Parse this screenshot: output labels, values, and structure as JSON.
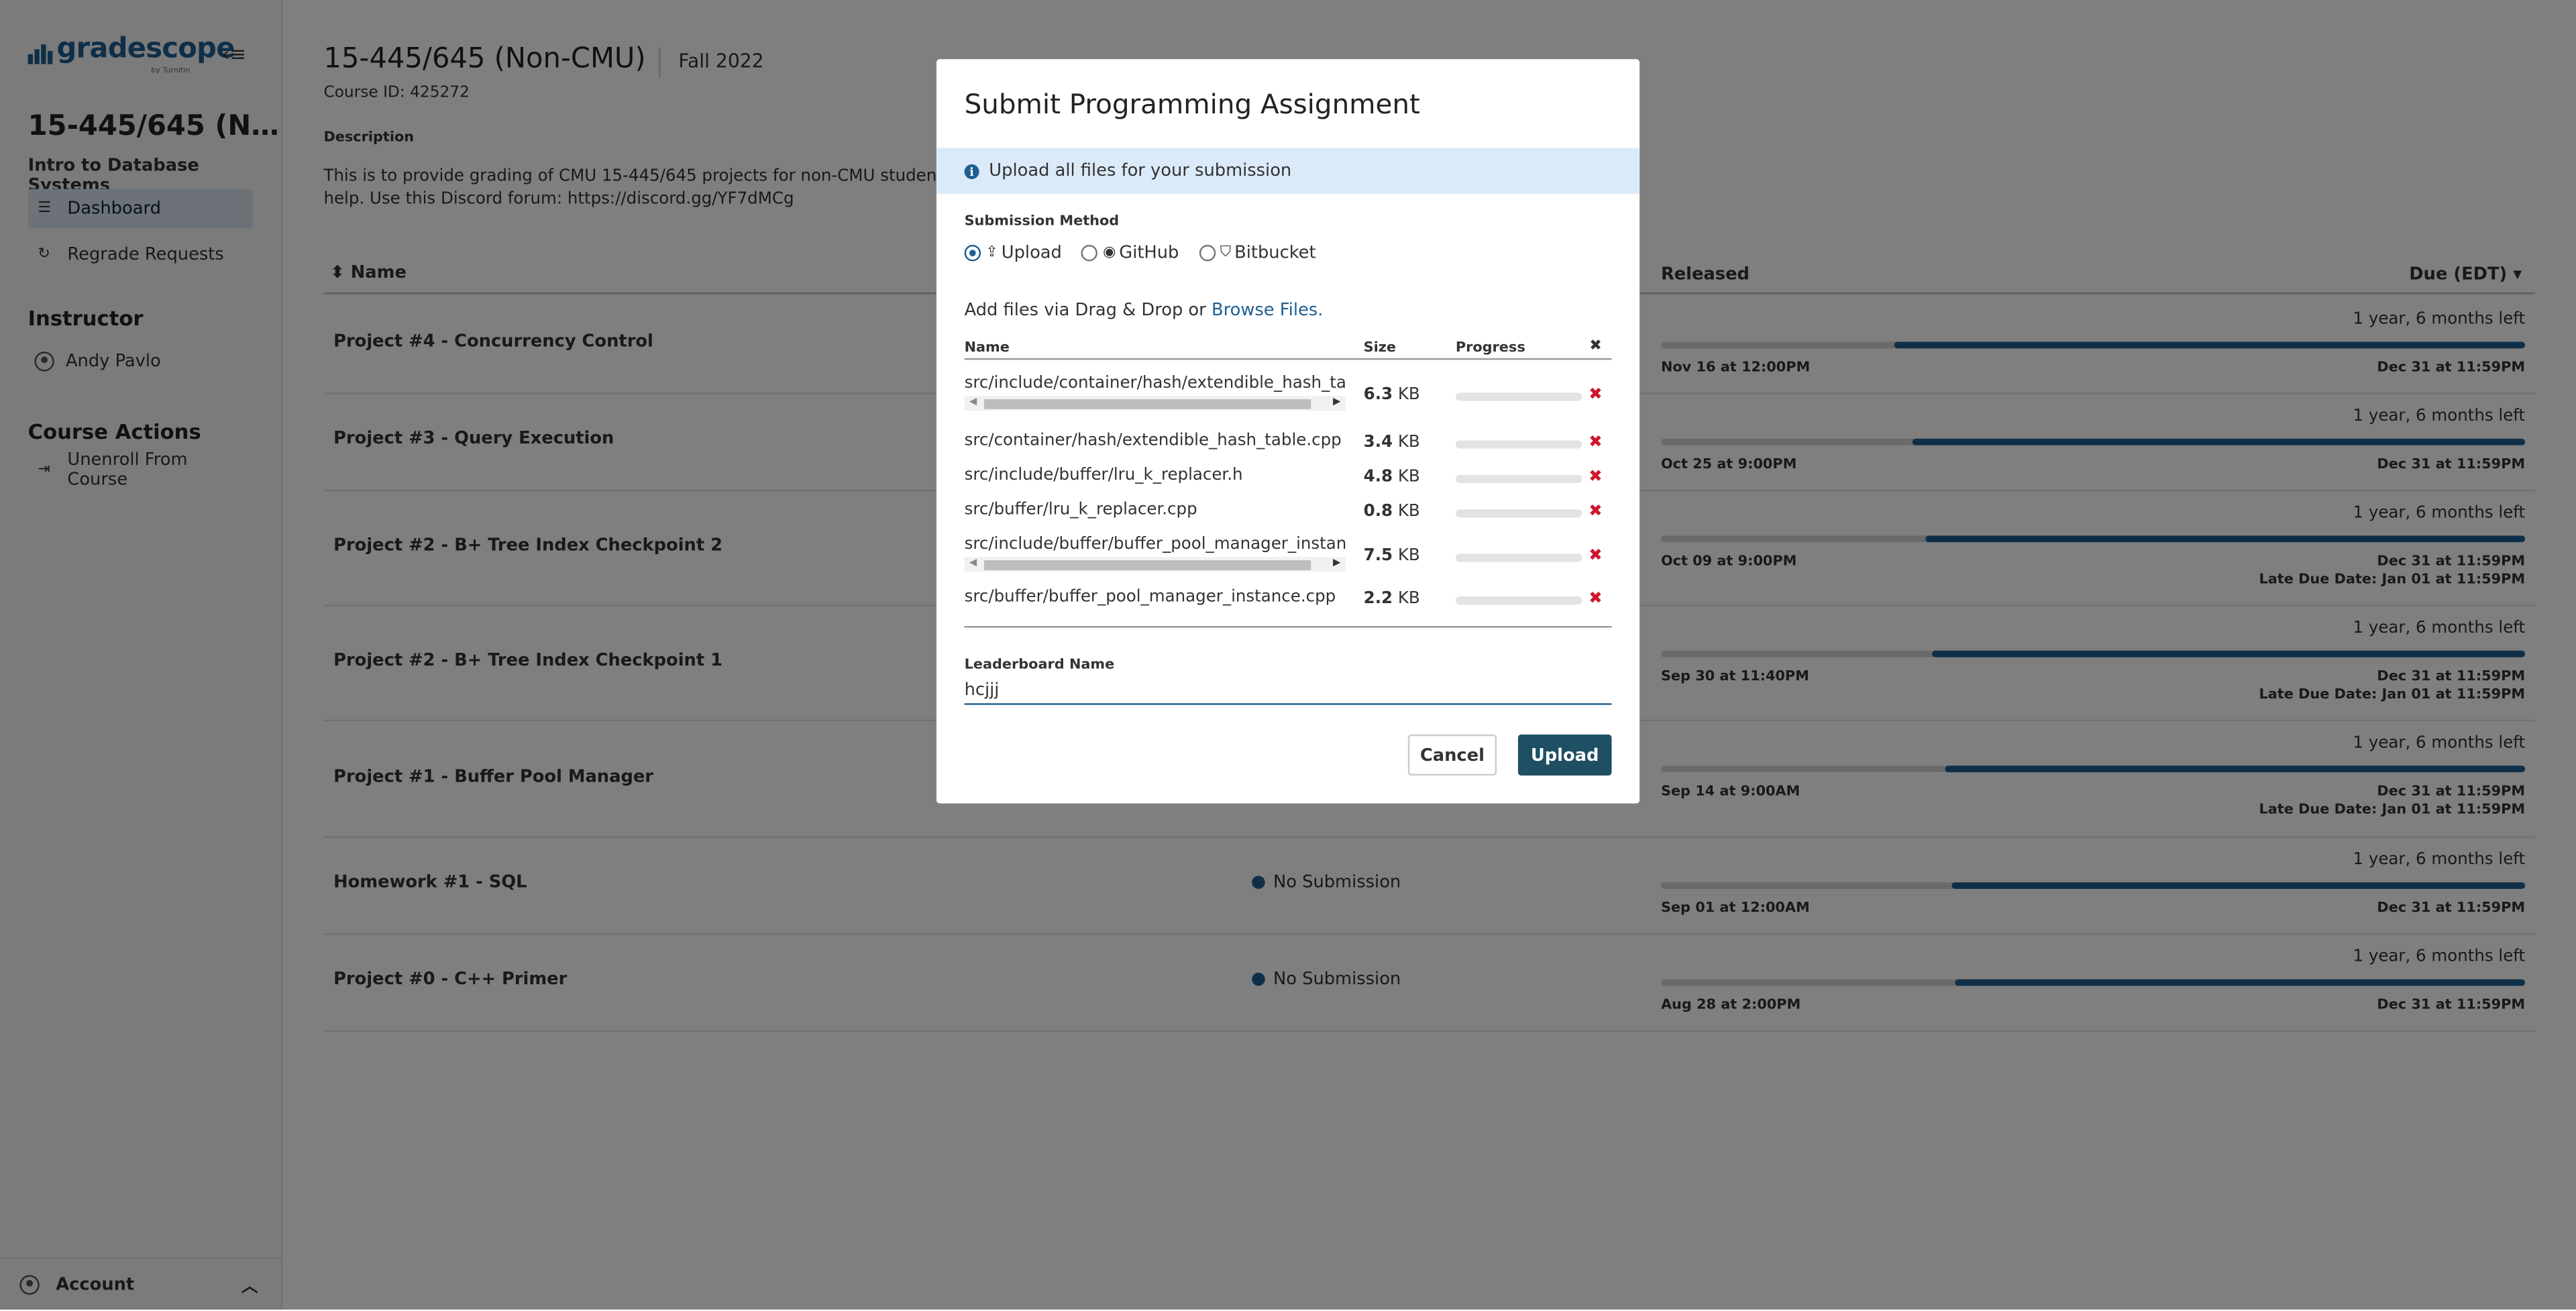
{
  "app": {
    "logo_text": "gradescope",
    "logo_sub": "by Turnitin",
    "collapse_icon": "collapse-icon"
  },
  "sidebar": {
    "course_short": "15-445/645 (N…",
    "course_name": "Intro to Database Systems",
    "nav": [
      {
        "label": "Dashboard",
        "icon": "dashboard-icon",
        "active": true
      },
      {
        "label": "Regrade Requests",
        "icon": "refresh-icon",
        "active": false
      }
    ],
    "instructor_heading": "Instructor",
    "instructor_name": "Andy Pavlo",
    "course_actions_heading": "Course Actions",
    "unenroll_label": "Unenroll From Course",
    "account_label": "Account"
  },
  "course": {
    "title": "15-445/645 (Non-CMU)",
    "term": "Fall 2022",
    "course_id": "Course ID: 425272",
    "description_label": "Description",
    "description_line1": "This is to provide grading of CMU 15-445/645 projects for non-CMU students. Do",
    "description_line2": "help. Use this Discord forum: https://discord.gg/YF7dMCg"
  },
  "table": {
    "col_name": "Name",
    "col_released": "Released",
    "col_due": "Due (EDT)",
    "rows": [
      {
        "name": "Project #4 - Concurrency Control",
        "status": "",
        "time_left": "1 year, 6 months left",
        "released": "Nov 16 at 12:00PM",
        "due": "Dec 31 at 11:59PM",
        "late": "",
        "elapsed_fraction": 0.27
      },
      {
        "name": "Project #3 - Query Execution",
        "status": "",
        "time_left": "1 year, 6 months left",
        "released": "Oct 25 at 9:00PM",
        "due": "Dec 31 at 11:59PM",
        "late": "",
        "elapsed_fraction": 0.29
      },
      {
        "name": "Project #2 - B+ Tree Index Checkpoint 2",
        "status": "",
        "time_left": "1 year, 6 months left",
        "released": "Oct 09 at 9:00PM",
        "due": "Dec 31 at 11:59PM",
        "late": "Late Due Date: Jan 01 at 11:59PM",
        "elapsed_fraction": 0.307
      },
      {
        "name": "Project #2 - B+ Tree Index Checkpoint 1",
        "status": "",
        "time_left": "1 year, 6 months left",
        "released": "Sep 30 at 11:40PM",
        "due": "Dec 31 at 11:59PM",
        "late": "Late Due Date: Jan 01 at 11:59PM",
        "elapsed_fraction": 0.313
      },
      {
        "name": "Project #1 - Buffer Pool Manager",
        "status": "",
        "time_left": "1 year, 6 months left",
        "released": "Sep 14 at 9:00AM",
        "due": "Dec 31 at 11:59PM",
        "late": "Late Due Date: Jan 01 at 11:59PM",
        "elapsed_fraction": 0.328
      },
      {
        "name": "Homework #1 - SQL",
        "status": "No Submission",
        "time_left": "1 year, 6 months left",
        "released": "Sep 01 at 12:00AM",
        "due": "Dec 31 at 11:59PM",
        "late": "",
        "elapsed_fraction": 0.337
      },
      {
        "name": "Project #0 - C++ Primer",
        "status": "No Submission",
        "time_left": "1 year, 6 months left",
        "released": "Aug 28 at 2:00PM",
        "due": "Dec 31 at 11:59PM",
        "late": "",
        "elapsed_fraction": 0.34
      }
    ]
  },
  "modal": {
    "title": "Submit Programming Assignment",
    "info": "Upload all files for your submission",
    "method_label": "Submission Method",
    "methods": [
      {
        "label": "Upload",
        "icon": "upload-icon",
        "checked": true
      },
      {
        "label": "GitHub",
        "icon": "github-icon",
        "checked": false
      },
      {
        "label": "Bitbucket",
        "icon": "bitbucket-icon",
        "checked": false
      }
    ],
    "add_files_text": "Add files via Drag & Drop or ",
    "browse_link": "Browse Files.",
    "files_header": {
      "name": "Name",
      "size": "Size",
      "progress": "Progress"
    },
    "files": [
      {
        "name": "src/include/container/hash/extendible_hash_table.h",
        "size_value": "6.3",
        "size_unit": "KB",
        "scrollbar": true
      },
      {
        "name": "src/container/hash/extendible_hash_table.cpp",
        "size_value": "3.4",
        "size_unit": "KB",
        "scrollbar": false
      },
      {
        "name": "src/include/buffer/lru_k_replacer.h",
        "size_value": "4.8",
        "size_unit": "KB",
        "scrollbar": false
      },
      {
        "name": "src/buffer/lru_k_replacer.cpp",
        "size_value": "0.8",
        "size_unit": "KB",
        "scrollbar": false
      },
      {
        "name": "src/include/buffer/buffer_pool_manager_instance.h",
        "size_value": "7.5",
        "size_unit": "KB",
        "scrollbar": true
      },
      {
        "name": "src/buffer/buffer_pool_manager_instance.cpp",
        "size_value": "2.2",
        "size_unit": "KB",
        "scrollbar": false
      }
    ],
    "leaderboard_label": "Leaderboard Name",
    "leaderboard_value": "hcjjj",
    "cancel_label": "Cancel",
    "upload_label": "Upload"
  },
  "colors": {
    "brand": "#1f5f92",
    "upload_button": "#1e4f63",
    "delete": "#d0142c",
    "info_bg": "#dbeaf8"
  }
}
